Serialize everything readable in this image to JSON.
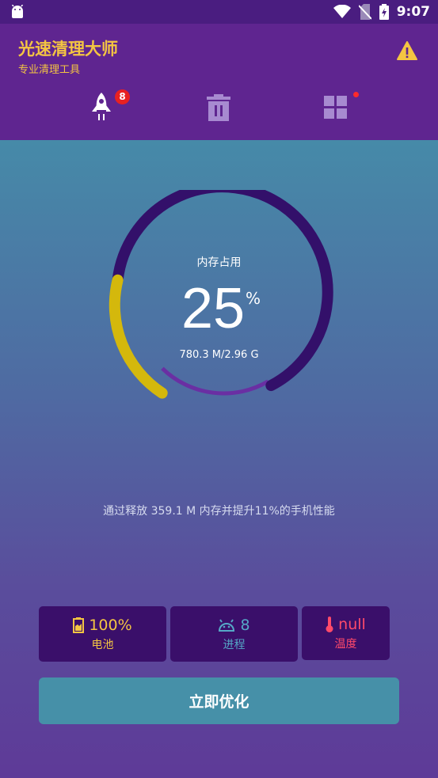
{
  "status_bar": {
    "time": "9:07"
  },
  "header": {
    "title": "光速清理大师",
    "subtitle": "专业清理工具",
    "tabs": [
      {
        "icon": "rocket-icon",
        "badge": "8"
      },
      {
        "icon": "trash-icon"
      },
      {
        "icon": "grid-icon",
        "badge_dot": true
      }
    ]
  },
  "gauge": {
    "label": "内存占用",
    "value": "25",
    "unit": "%",
    "memory": "780.3 M/2.96 G",
    "fill_fraction": 0.25
  },
  "tip": "通过释放 359.1 M 内存并提升11%的手机性能",
  "stats": {
    "battery": {
      "value": "100%",
      "label": "电池"
    },
    "process": {
      "value": "8",
      "label": "进程"
    },
    "temperature": {
      "value": "null",
      "label": "温度"
    }
  },
  "action": {
    "label": "立即优化"
  },
  "colors": {
    "accent_yellow": "#f4c542",
    "header_purple": "#5f2590",
    "ring_dark": "#33106a",
    "badge_red": "#e82121",
    "button_teal": "#4690a8"
  }
}
